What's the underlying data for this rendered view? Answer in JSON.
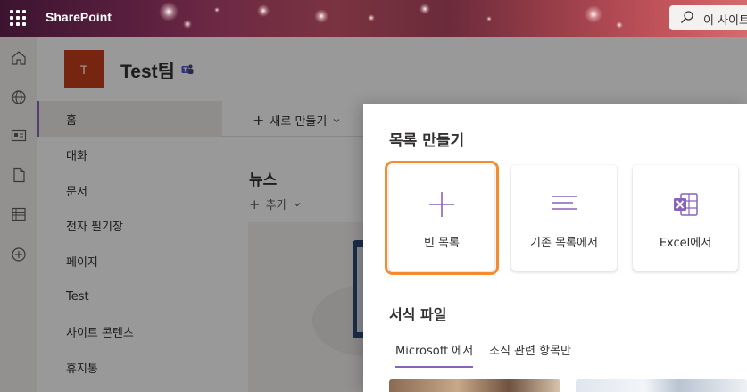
{
  "suite": {
    "brand": "SharePoint",
    "search_placeholder": "이 사이트",
    "gradient_colors": [
      "#3b1430",
      "#7a3340",
      "#d46a6e"
    ]
  },
  "app_bar": {
    "icons": [
      "home-icon",
      "globe-icon",
      "news-feed-icon",
      "document-icon",
      "list-icon",
      "add-icon"
    ]
  },
  "site": {
    "logo_letter": "T",
    "logo_color": "#c43e1c",
    "title": "Test팀"
  },
  "nav": {
    "items": [
      {
        "label": "홈",
        "selected": true
      },
      {
        "label": "대화"
      },
      {
        "label": "문서"
      },
      {
        "label": "전자 필기장"
      },
      {
        "label": "페이지"
      },
      {
        "label": "Test"
      },
      {
        "label": "사이트 콘텐츠"
      },
      {
        "label": "휴지통"
      }
    ]
  },
  "main": {
    "new_label": "새로 만들기",
    "news_title": "뉴스",
    "news_add_label": "추가"
  },
  "panel": {
    "title": "목록 만들기",
    "options": [
      {
        "label": "빈 목록",
        "icon": "plus-icon"
      },
      {
        "label": "기존 목록에서",
        "icon": "list-lines-icon"
      },
      {
        "label": "Excel에서",
        "icon": "excel-icon"
      }
    ],
    "templates_title": "서식 파일",
    "tabs": [
      {
        "label": "Microsoft 에서",
        "active": true
      },
      {
        "label": "조직 관련 항목만"
      }
    ],
    "accent_color": "#8764b8",
    "focus_color": "#f58a2e"
  }
}
